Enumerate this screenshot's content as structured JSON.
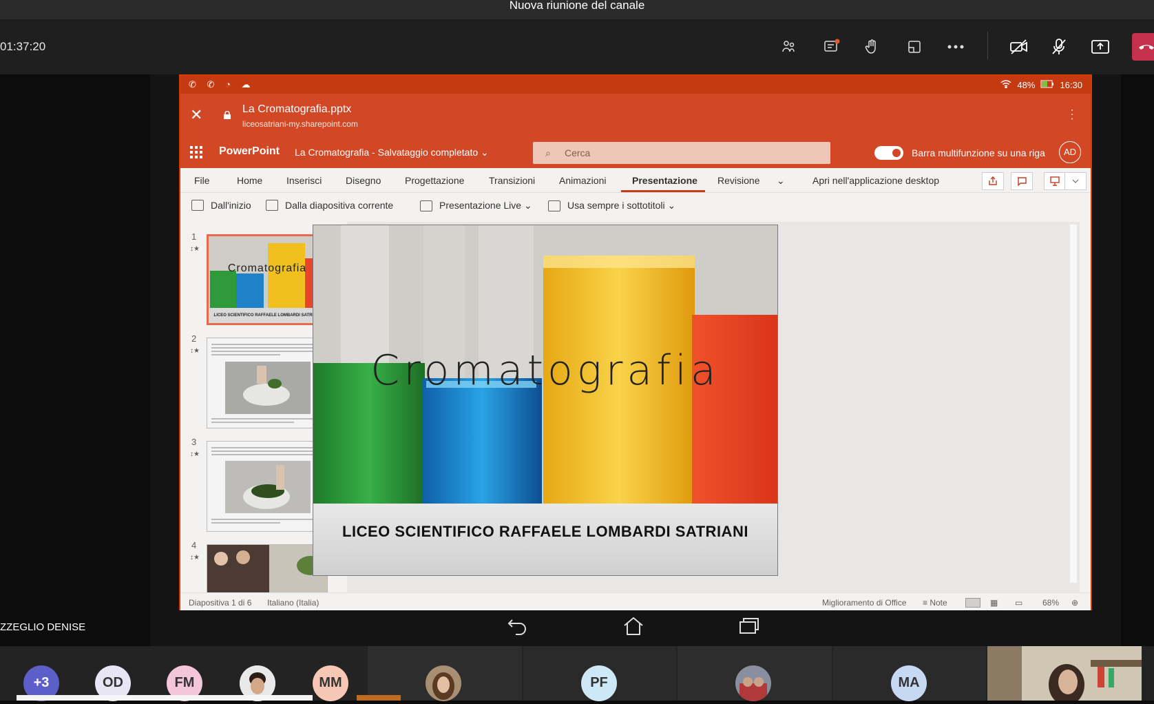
{
  "meeting": {
    "window_title": "Nuova riunione del canale",
    "elapsed": "01:37:20"
  },
  "toolbar_icons": [
    "participants-icon",
    "chat-icon",
    "raise-hand-icon",
    "rooms-icon",
    "more-icon",
    "camera-off-icon",
    "mic-off-icon",
    "share-icon",
    "leave-icon"
  ],
  "tablet_status": {
    "battery": "48%",
    "time": "16:30"
  },
  "browser": {
    "title": "La Cromatografia.pptx",
    "url": "liceosatriani-my.sharepoint.com"
  },
  "ppt": {
    "app_name": "PowerPoint",
    "doc_status": "La Cromatografia  -  Salvataggio completato ⌄",
    "search_placeholder": "Cerca",
    "toggle_label": "Barra multifunzione su una riga",
    "account_initials": "AD",
    "menu": [
      "File",
      "Home",
      "Inserisci",
      "Disegno",
      "Progettazione",
      "Transizioni",
      "Animazioni",
      "Presentazione",
      "Revisione"
    ],
    "open_desktop": "Apri nell'applicazione desktop",
    "ribbon": [
      "Dall'inizio",
      "Dalla diapositiva corrente",
      "Presentazione Live ⌄",
      "Usa sempre i sottotitoli ⌄"
    ],
    "thumb_numbers": [
      "1",
      "2",
      "3",
      "4"
    ],
    "thumb1_title": "Cromatografia",
    "thumb1_sub": "LICEO SCIENTIFICO RAFFAELE LOMBARDI SATRIANI",
    "slide_title": "Cromatografia",
    "slide_subtitle": "LICEO SCIENTIFICO RAFFAELE LOMBARDI SATRIANI",
    "status_left": "Diapositiva 1 di 6",
    "status_lang": "Italiano (Italia)",
    "status_improve": "Miglioramento di Office",
    "status_notes": "≡ Note",
    "zoom": "68%"
  },
  "presenter_name": "ZZEGLIO DENISE",
  "attendees": [
    {
      "initials": "+3",
      "color": "#5b5fc7"
    },
    {
      "initials": "OD",
      "color": "#e8e6f5"
    },
    {
      "initials": "FM",
      "color": "#f4c6da"
    },
    {
      "initials": "MM",
      "color": "#f6c7b4"
    },
    {
      "initials": "PF",
      "color": "#cde8f7"
    },
    {
      "initials": "MA",
      "color": "#c7d8f3"
    }
  ]
}
